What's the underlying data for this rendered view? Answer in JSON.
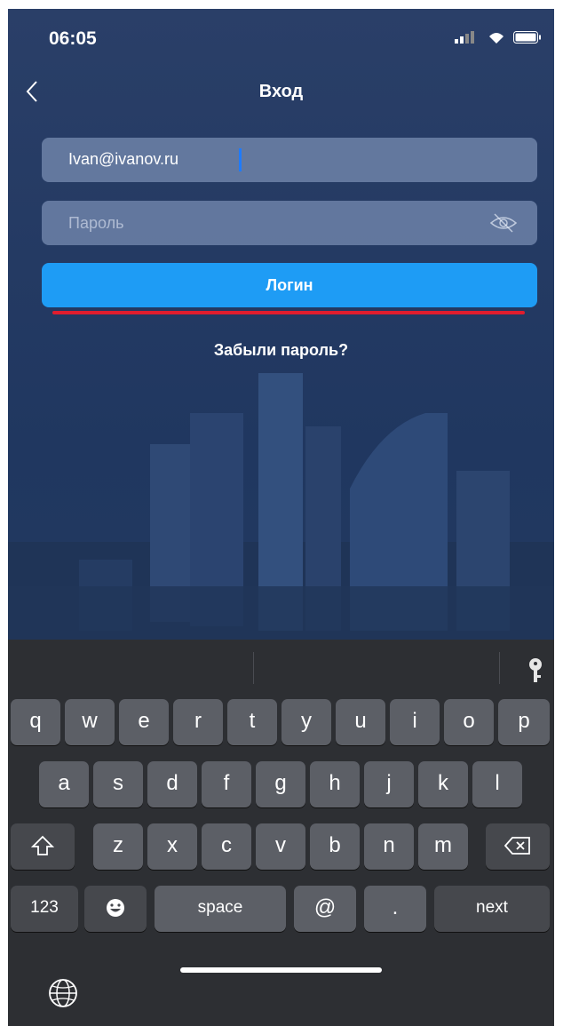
{
  "status": {
    "time": "06:05"
  },
  "nav": {
    "title": "Вход"
  },
  "form": {
    "email_value": "Ivan@ivanov.ru",
    "password_placeholder": "Пароль",
    "login_label": "Логин",
    "forgot_label": "Забыли пароль?"
  },
  "keyboard": {
    "row1": [
      "q",
      "w",
      "e",
      "r",
      "t",
      "y",
      "u",
      "i",
      "o",
      "p"
    ],
    "row2": [
      "a",
      "s",
      "d",
      "f",
      "g",
      "h",
      "j",
      "k",
      "l"
    ],
    "row3": [
      "z",
      "x",
      "c",
      "v",
      "b",
      "n",
      "m"
    ],
    "numbers": "123",
    "space": "space",
    "at": "@",
    "dot": ".",
    "next": "next"
  },
  "colors": {
    "accent": "#1e9cf5",
    "underline": "#e01d2e",
    "keyboard_bg": "#2d2f33"
  }
}
